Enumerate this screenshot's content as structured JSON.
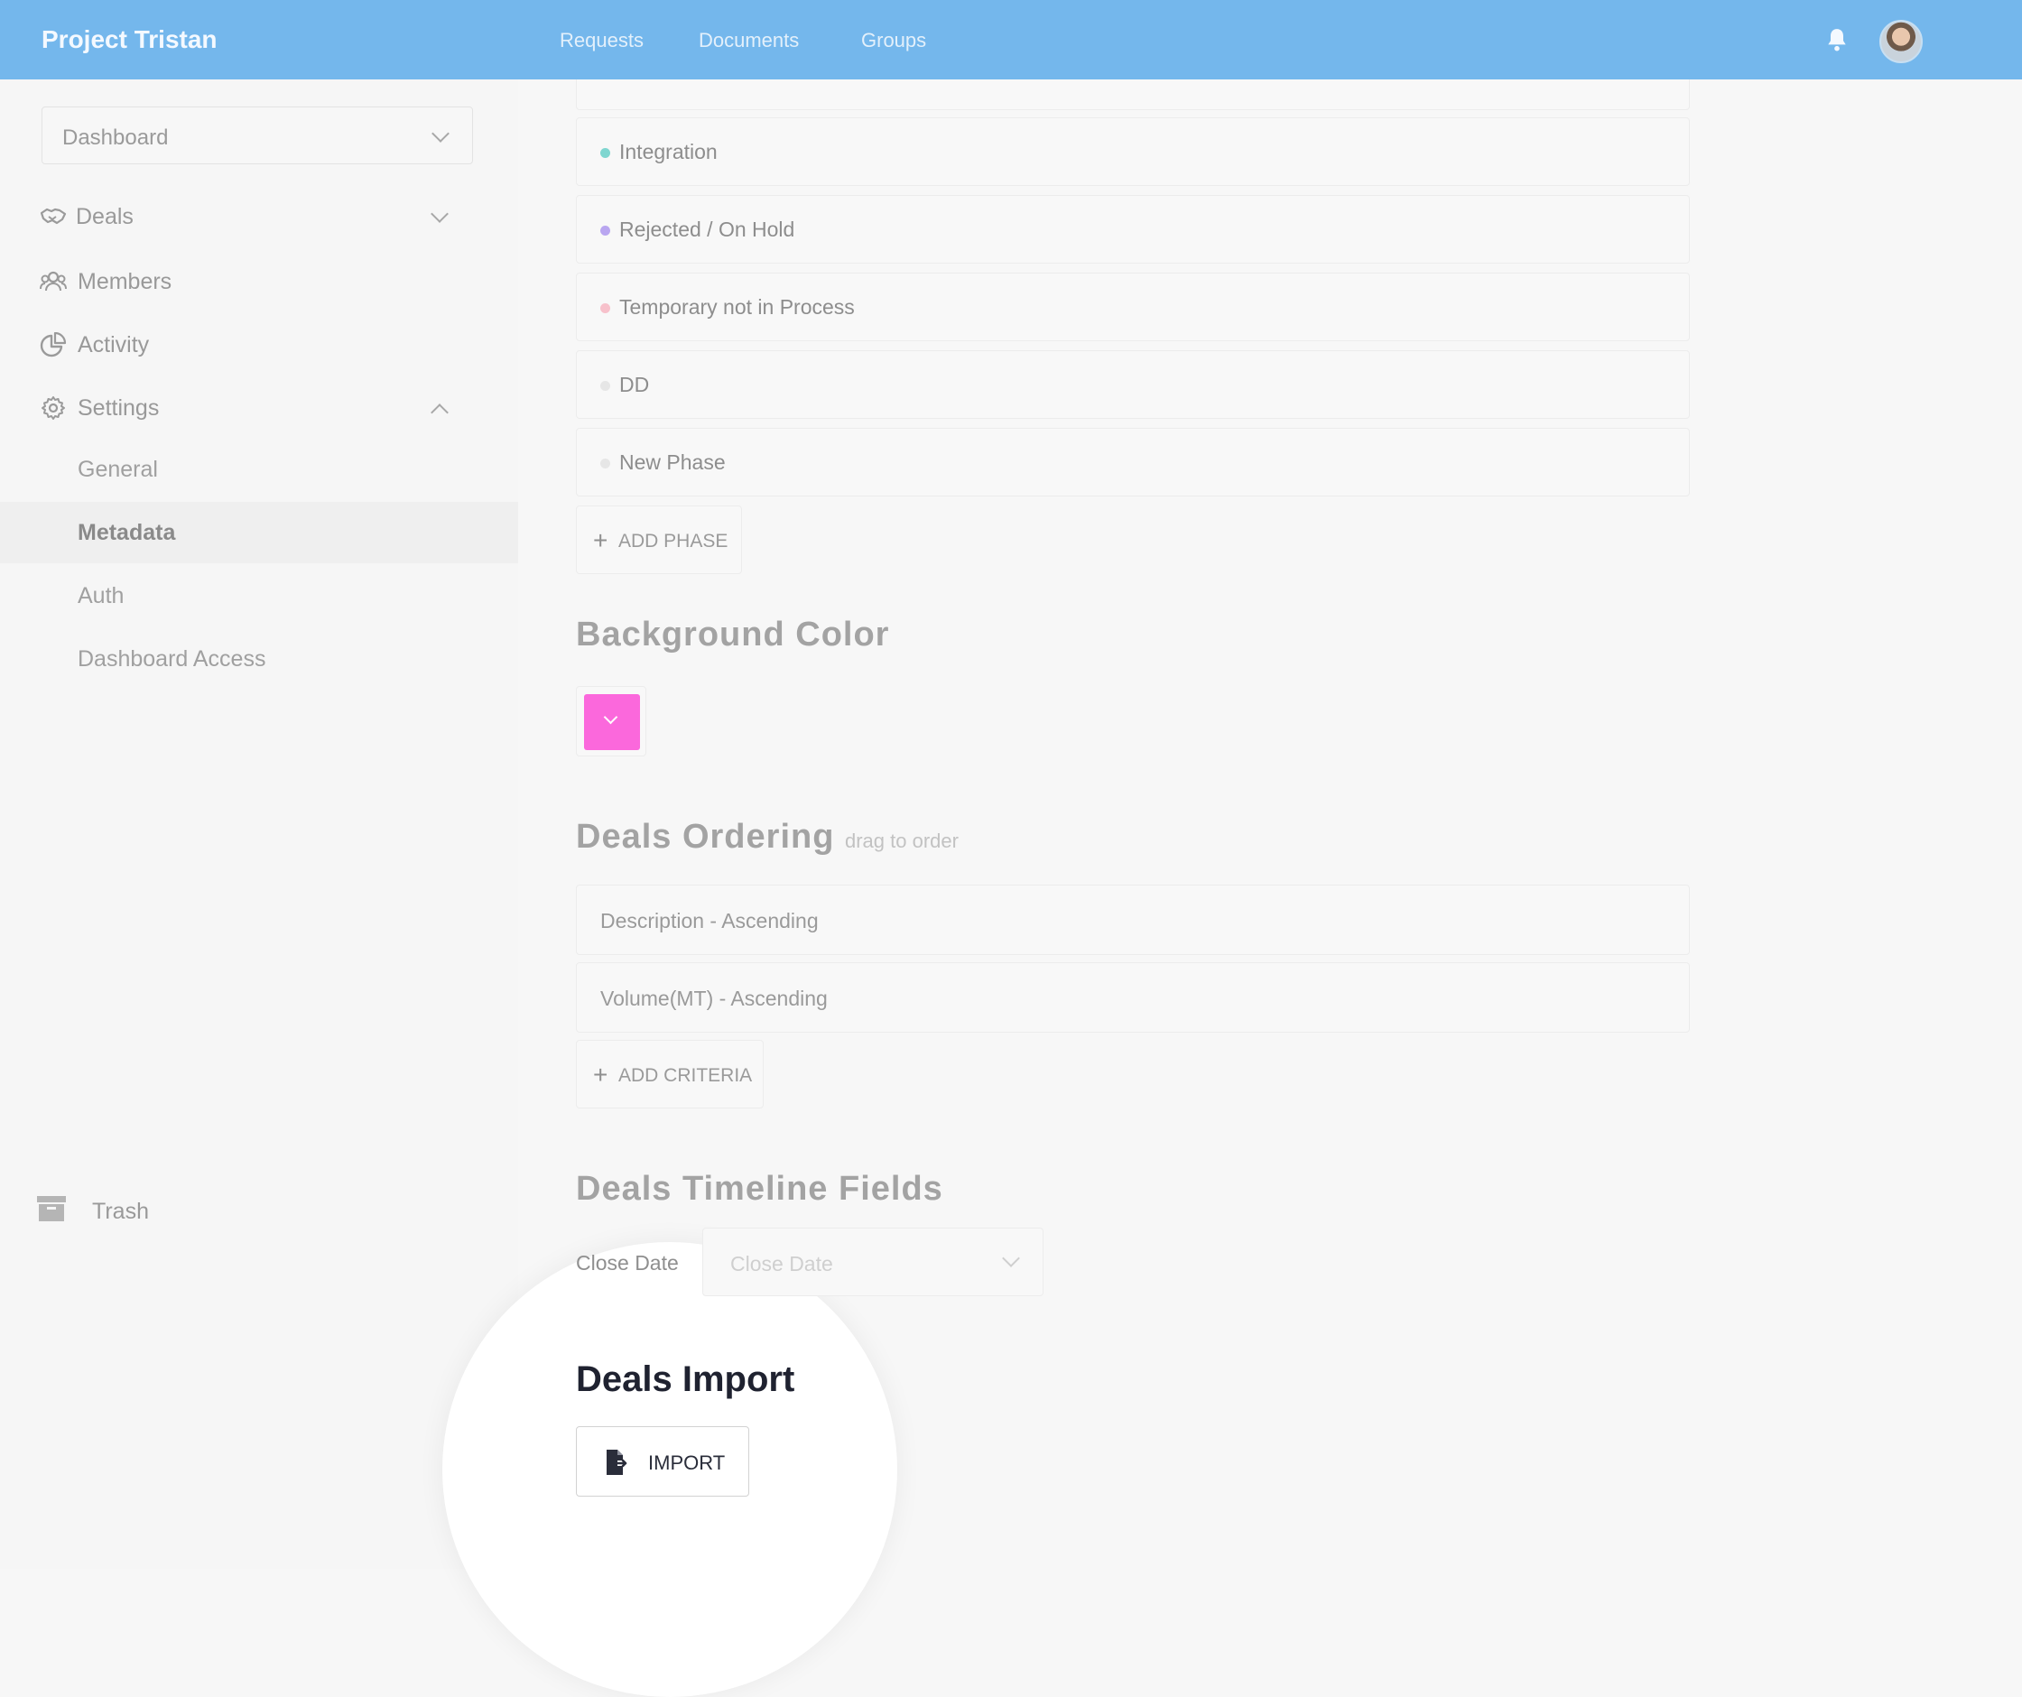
{
  "topbar": {
    "brand": "Project Tristan",
    "nav": [
      "Requests",
      "Documents",
      "Groups"
    ],
    "bell_icon": "bell-icon",
    "avatar_icon": "user-avatar"
  },
  "sidebar": {
    "dashboard_select": "Dashboard",
    "items": [
      {
        "label": "Deals",
        "icon": "handshake-icon"
      },
      {
        "label": "Members",
        "icon": "users-icon"
      },
      {
        "label": "Activity",
        "icon": "pie-chart-icon"
      },
      {
        "label": "Settings",
        "icon": "gear-icon"
      }
    ],
    "settings_sub": [
      "General",
      "Metadata",
      "Auth",
      "Dashboard Access"
    ],
    "active_sub": "Metadata",
    "trash": "Trash"
  },
  "phases": [
    {
      "label": "Integration",
      "color": "#7fd6d0"
    },
    {
      "label": "Rejected / On Hold",
      "color": "#b9a6f0"
    },
    {
      "label": "Temporary not in Process",
      "color": "#f7c1cb"
    },
    {
      "label": "DD",
      "color": "#e6e6e6"
    },
    {
      "label": "New Phase",
      "color": "#e6e6e6"
    }
  ],
  "add_phase": "ADD PHASE",
  "background_color": {
    "title": "Background Color",
    "value": "#fb68dc"
  },
  "ordering": {
    "title": "Deals Ordering",
    "hint": "drag to order",
    "criteria": [
      "Description - Ascending",
      "Volume(MT) - Ascending"
    ],
    "add_label": "ADD CRITERIA"
  },
  "timeline": {
    "title": "Deals Timeline Fields",
    "field_label": "Close Date",
    "placeholder": "Close Date"
  },
  "import": {
    "title": "Deals Import",
    "button": "IMPORT"
  }
}
